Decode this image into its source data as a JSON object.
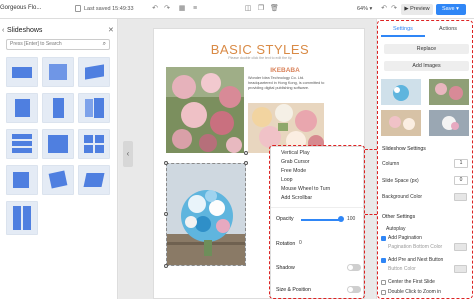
{
  "topbar": {
    "doc_title": "Gorgeous Flo...",
    "saved_text": "Last saved 15:49:33",
    "zoom": "64%",
    "preview_label": "Preview",
    "save_label": "Save"
  },
  "left_panel": {
    "title": "Slideshows",
    "search_placeholder": "Press [Enter] to Search"
  },
  "page": {
    "title": "BASIC STYLES",
    "subtitle": "Please double click the text to edit the tip",
    "heading": "IKEBABA",
    "body": "Wonder Idea Technology Co. Ltd. headquartered in Hong Kong, is committed to providing digital publishing software."
  },
  "popup": {
    "menu": [
      "Vertical Play",
      "Grab Cursor",
      "Free Mode",
      "Loop",
      "Mouse Wheel to Turn",
      "Add Scrollbar"
    ],
    "opacity_label": "Opacity",
    "opacity_value": "100",
    "opacity_level": 1.0,
    "rotation_label": "Rotation",
    "rotation_value": "0",
    "shadow_label": "Shadow",
    "size_label": "Size & Position"
  },
  "right_panel": {
    "tabs": [
      "Settings",
      "Actions"
    ],
    "replace_label": "Replace",
    "add_images_label": "Add Images",
    "slideshow_settings": "Slideshow Settings",
    "column_label": "Column",
    "column_value": "1",
    "slide_space_label": "Slide Space (px)",
    "slide_space_value": "0",
    "bg_color_label": "Background Color",
    "other_settings": "Other Settings",
    "autoplay": "Autoplay",
    "add_pagination": "Add Pagination",
    "pagination_bottom_color": "Pagination Bottom Color",
    "add_prev_next": "Add Pre and Next Button",
    "button_color": "Button Color",
    "center_first_slide": "Center the First Slide",
    "double_click_zoom": "Double Click to Zoom in"
  },
  "colors": {
    "accent": "#2f86f6",
    "title_orange": "#d98a45",
    "highlight_red": "#dd2222"
  }
}
